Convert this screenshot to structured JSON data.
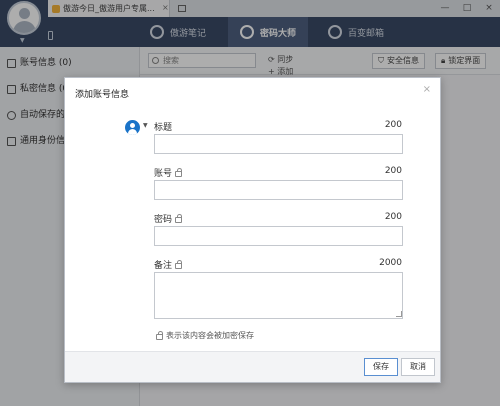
{
  "browser": {
    "tab_title": "傲游今日_傲游用户专属...",
    "tab_close": "×",
    "window_controls": [
      "—",
      "□",
      "×"
    ]
  },
  "sidebar": {
    "items": [
      {
        "label": "账号信息 (0)",
        "icon": "user-card-icon"
      },
      {
        "label": "私密信息 (0)",
        "icon": "note-icon"
      },
      {
        "label": "自动保存的",
        "icon": "key-icon"
      },
      {
        "label": "通用身份信",
        "icon": "id-card-icon"
      }
    ]
  },
  "appnav": {
    "items": [
      {
        "label": "傲游笔记",
        "icon": "notes-icon",
        "active": false
      },
      {
        "label": "密码大师",
        "icon": "password-master-icon",
        "active": true
      },
      {
        "label": "百变邮箱",
        "icon": "at-mail-icon",
        "active": false
      }
    ]
  },
  "toolbar": {
    "search_placeholder": "搜索",
    "sync_label": "同步",
    "add_label": "添加",
    "security_label": "安全信息",
    "lock_label": "锁定界面"
  },
  "dialog": {
    "title": "添加账号信息",
    "close": "×",
    "fields": [
      {
        "label": "标题",
        "max": "200",
        "value": ""
      },
      {
        "label": "账号",
        "max": "200",
        "value": ""
      },
      {
        "label": "密码",
        "max": "200",
        "value": ""
      },
      {
        "label": "备注",
        "max": "2000",
        "value": ""
      }
    ],
    "encrypt_note": "表示该内容会被加密保存",
    "save_label": "保存",
    "cancel_label": "取消"
  },
  "colors": {
    "nav_bg": "#3a4b66",
    "nav_active": "#4f6180",
    "accent": "#1a73c8"
  }
}
